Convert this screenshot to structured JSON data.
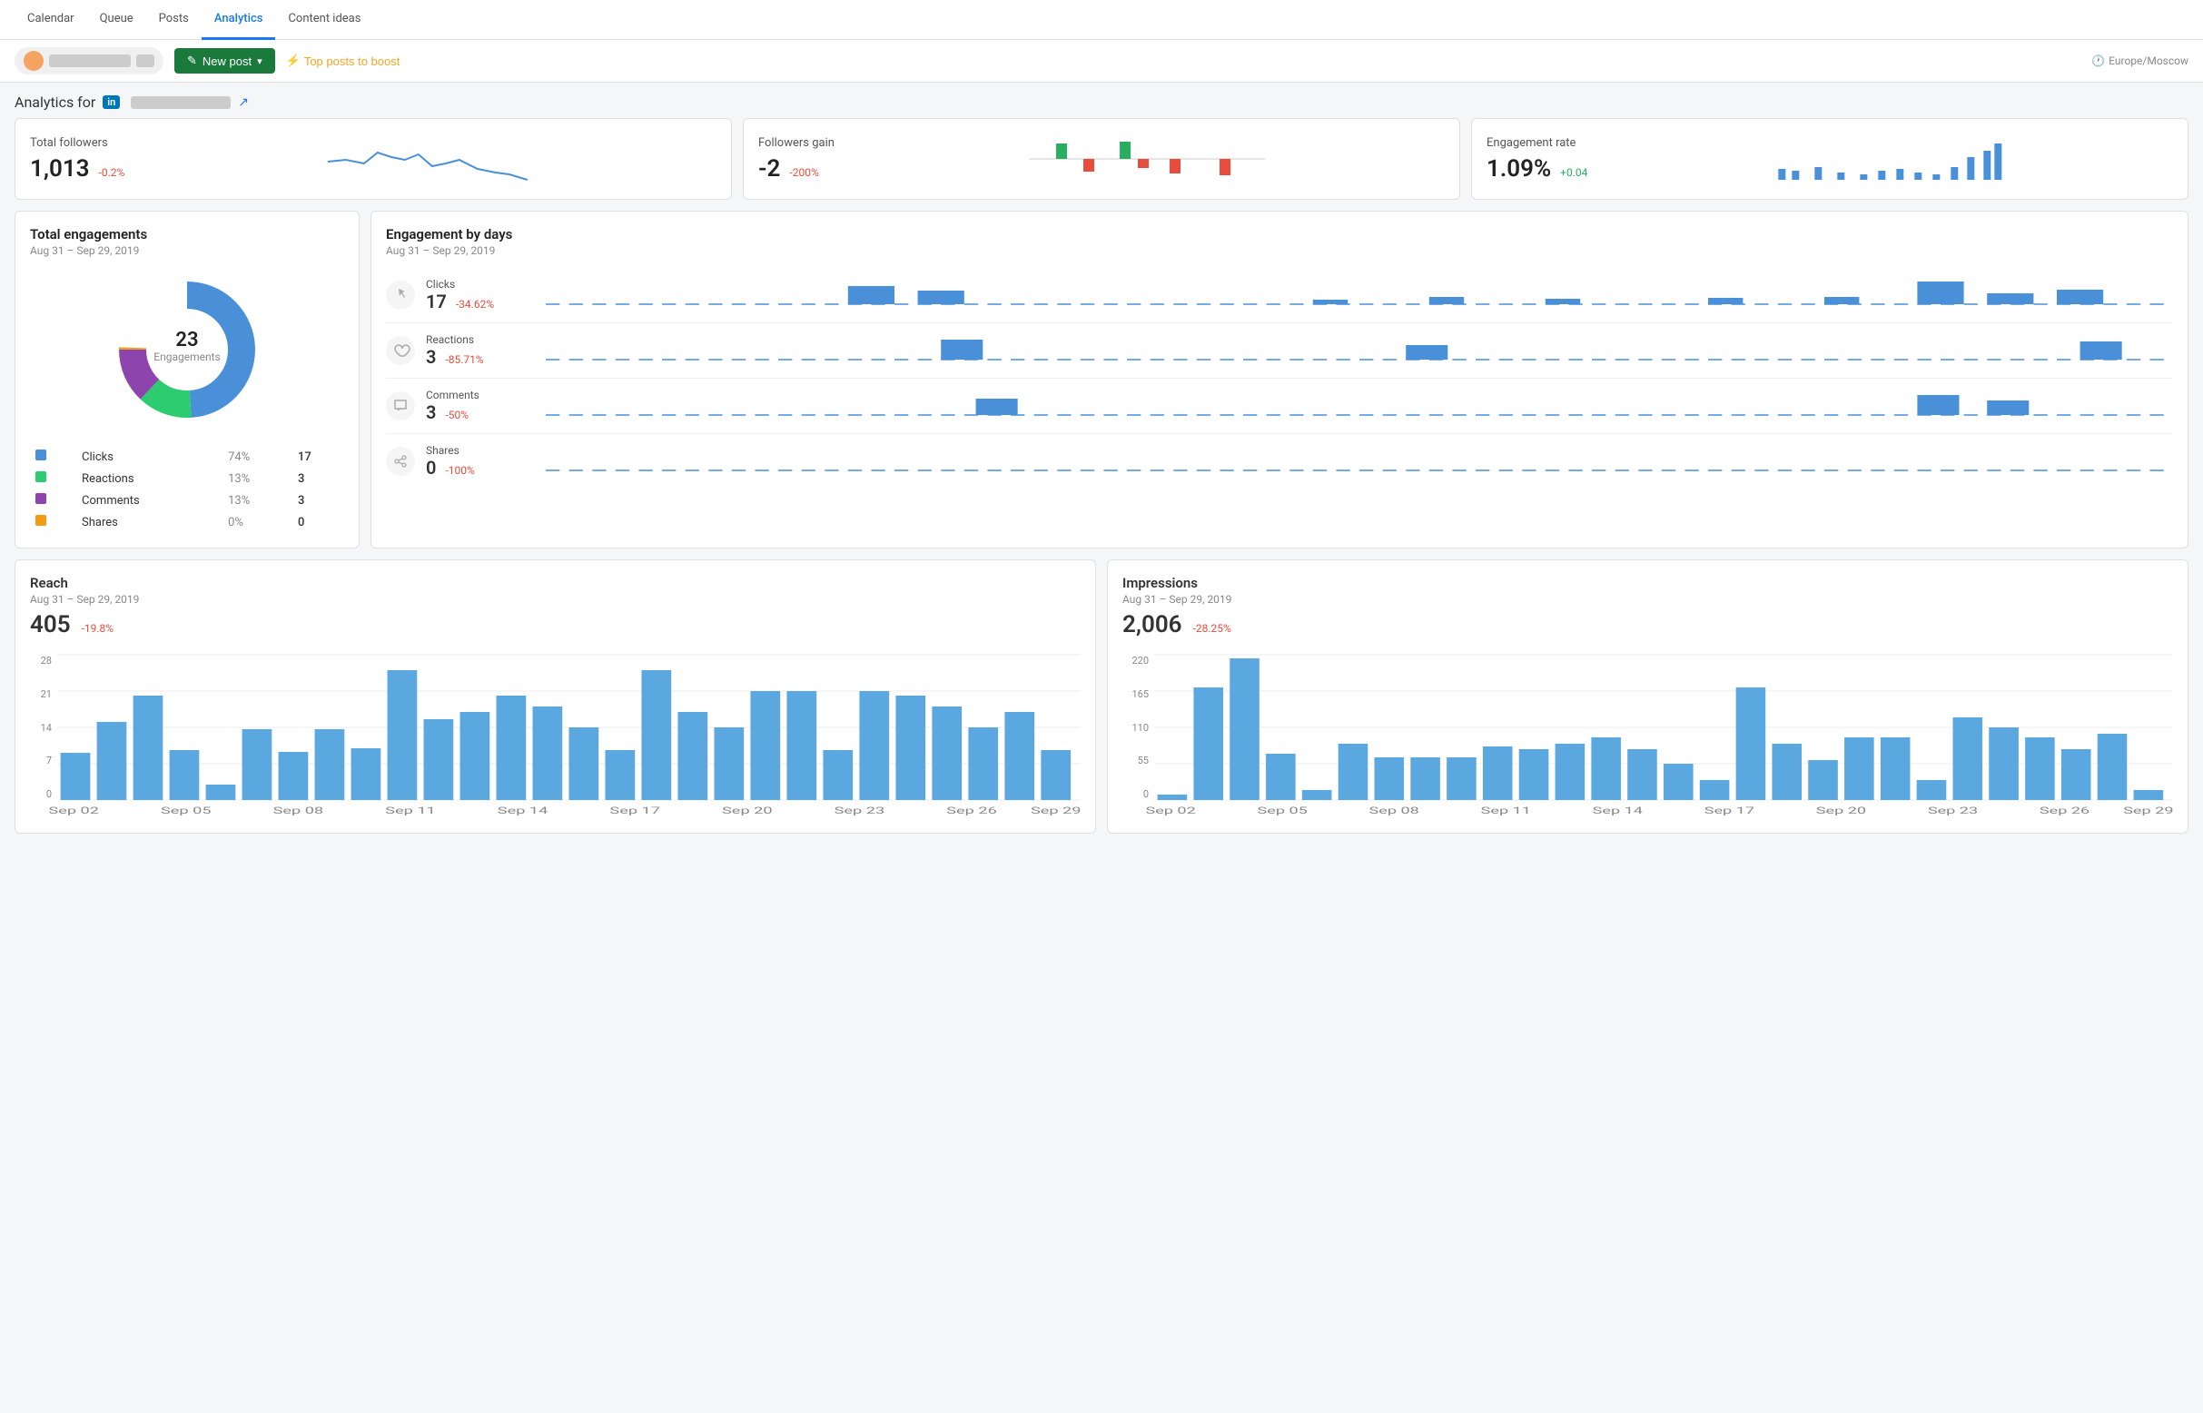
{
  "nav": {
    "tabs": [
      "Calendar",
      "Queue",
      "Posts",
      "Analytics",
      "Content ideas"
    ],
    "active": "Analytics"
  },
  "toolbar": {
    "new_post_label": "New post",
    "boost_label": "Top posts to boost",
    "timezone": "Europe/Moscow"
  },
  "page_header": {
    "prefix": "Analytics for",
    "platform": "in",
    "external_link_title": "Open profile"
  },
  "total_followers": {
    "label": "Total followers",
    "value": "1,013",
    "change": "-0.2%",
    "change_type": "negative"
  },
  "followers_gain": {
    "label": "Followers gain",
    "value": "-2",
    "change": "-200%",
    "change_type": "negative"
  },
  "engagement_rate": {
    "label": "Engagement rate",
    "value": "1.09%",
    "change": "+0.04",
    "change_type": "positive"
  },
  "total_engagements": {
    "title": "Total engagements",
    "subtitle": "Aug 31 – Sep 29, 2019",
    "total": "23",
    "total_label": "Engagements",
    "legend": [
      {
        "label": "Clicks",
        "color": "#4a90d9",
        "pct": "74%",
        "val": "17"
      },
      {
        "label": "Reactions",
        "color": "#2ecc71",
        "pct": "13%",
        "val": "3"
      },
      {
        "label": "Comments",
        "color": "#8e44ad",
        "pct": "13%",
        "val": "3"
      },
      {
        "label": "Shares",
        "color": "#f39c12",
        "pct": "0%",
        "val": "0"
      }
    ]
  },
  "engagement_by_days": {
    "title": "Engagement by days",
    "subtitle": "Aug 31 – Sep 29, 2019",
    "metrics": [
      {
        "label": "Clicks",
        "value": "17",
        "change": "-34.62%",
        "change_type": "negative"
      },
      {
        "label": "Reactions",
        "value": "3",
        "change": "-85.71%",
        "change_type": "negative"
      },
      {
        "label": "Comments",
        "value": "3",
        "change": "-50%",
        "change_type": "negative"
      },
      {
        "label": "Shares",
        "value": "0",
        "change": "-100%",
        "change_type": "negative"
      }
    ]
  },
  "reach": {
    "title": "Reach",
    "subtitle": "Aug 31 – Sep 29, 2019",
    "value": "405",
    "change": "-19.8%",
    "change_type": "negative",
    "y_labels": [
      "28",
      "21",
      "14",
      "7",
      "0"
    ],
    "x_labels": [
      "Sep 02",
      "Sep 05",
      "Sep 08",
      "Sep 11",
      "Sep 14",
      "Sep 17",
      "Sep 20",
      "Sep 23",
      "Sep 26",
      "Sep 29"
    ],
    "bars": [
      9,
      16,
      20,
      8,
      3,
      13,
      9,
      13,
      10,
      25,
      12,
      17,
      20,
      18,
      14,
      8,
      25,
      17,
      14,
      22,
      22,
      8,
      22,
      21,
      19,
      14,
      17,
      8
    ]
  },
  "impressions": {
    "title": "Impressions",
    "subtitle": "Aug 31 – Sep 29, 2019",
    "value": "2,006",
    "change": "-28.25%",
    "change_type": "negative",
    "y_labels": [
      "220",
      "165",
      "110",
      "55",
      "0"
    ],
    "x_labels": [
      "Sep 02",
      "Sep 05",
      "Sep 08",
      "Sep 11",
      "Sep 14",
      "Sep 17",
      "Sep 20",
      "Sep 23",
      "Sep 26",
      "Sep 29"
    ],
    "bars": [
      8,
      170,
      215,
      70,
      15,
      85,
      65,
      65,
      65,
      80,
      75,
      85,
      95,
      75,
      55,
      30,
      165,
      85,
      60,
      95,
      95,
      30,
      125,
      110,
      95,
      75,
      100,
      15
    ]
  }
}
